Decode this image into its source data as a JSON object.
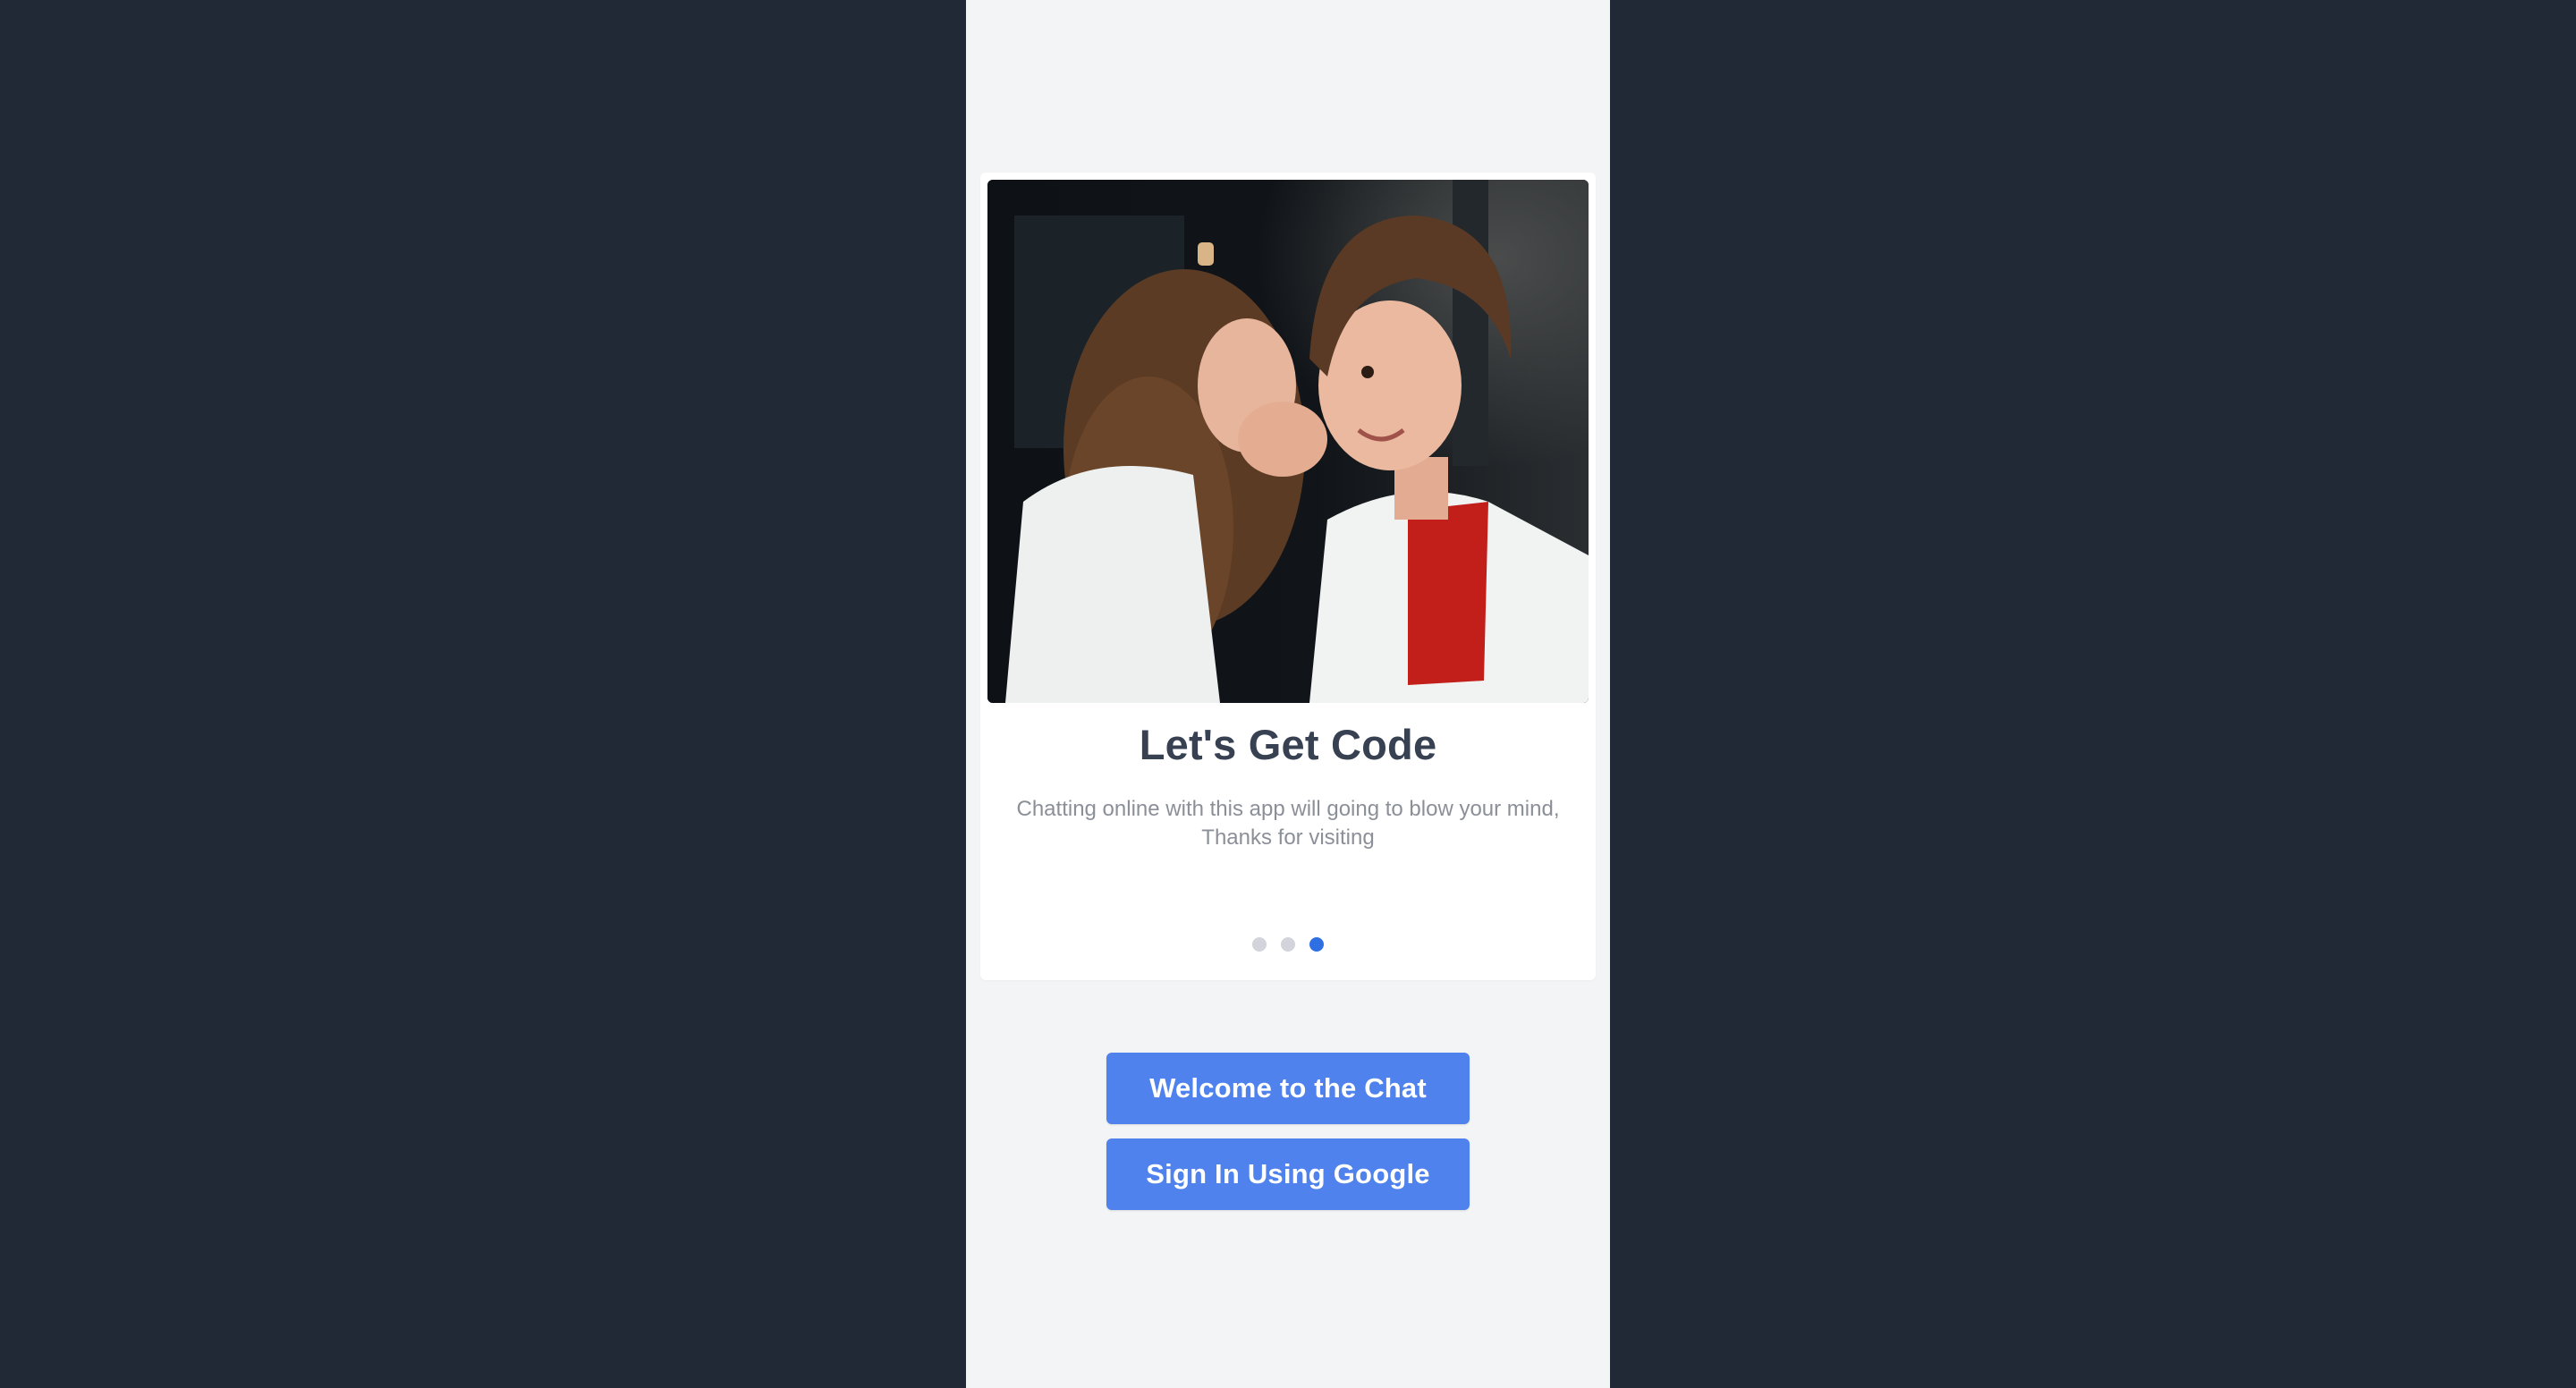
{
  "onboarding": {
    "slide": {
      "title": "Let's Get Code",
      "description": "Chatting online with this app will going to blow your mind, Thanks for visiting",
      "image_alt": "Two children whispering"
    },
    "pagination": {
      "total": 3,
      "active_index": 2
    }
  },
  "actions": {
    "welcome_label": "Welcome to the Chat",
    "google_label": "Sign In Using Google"
  },
  "colors": {
    "background": "#212836",
    "screen": "#f3f4f6",
    "accent": "#4f82ec",
    "active_dot": "#2f6fe4",
    "inactive_dot": "#d1d5db"
  }
}
